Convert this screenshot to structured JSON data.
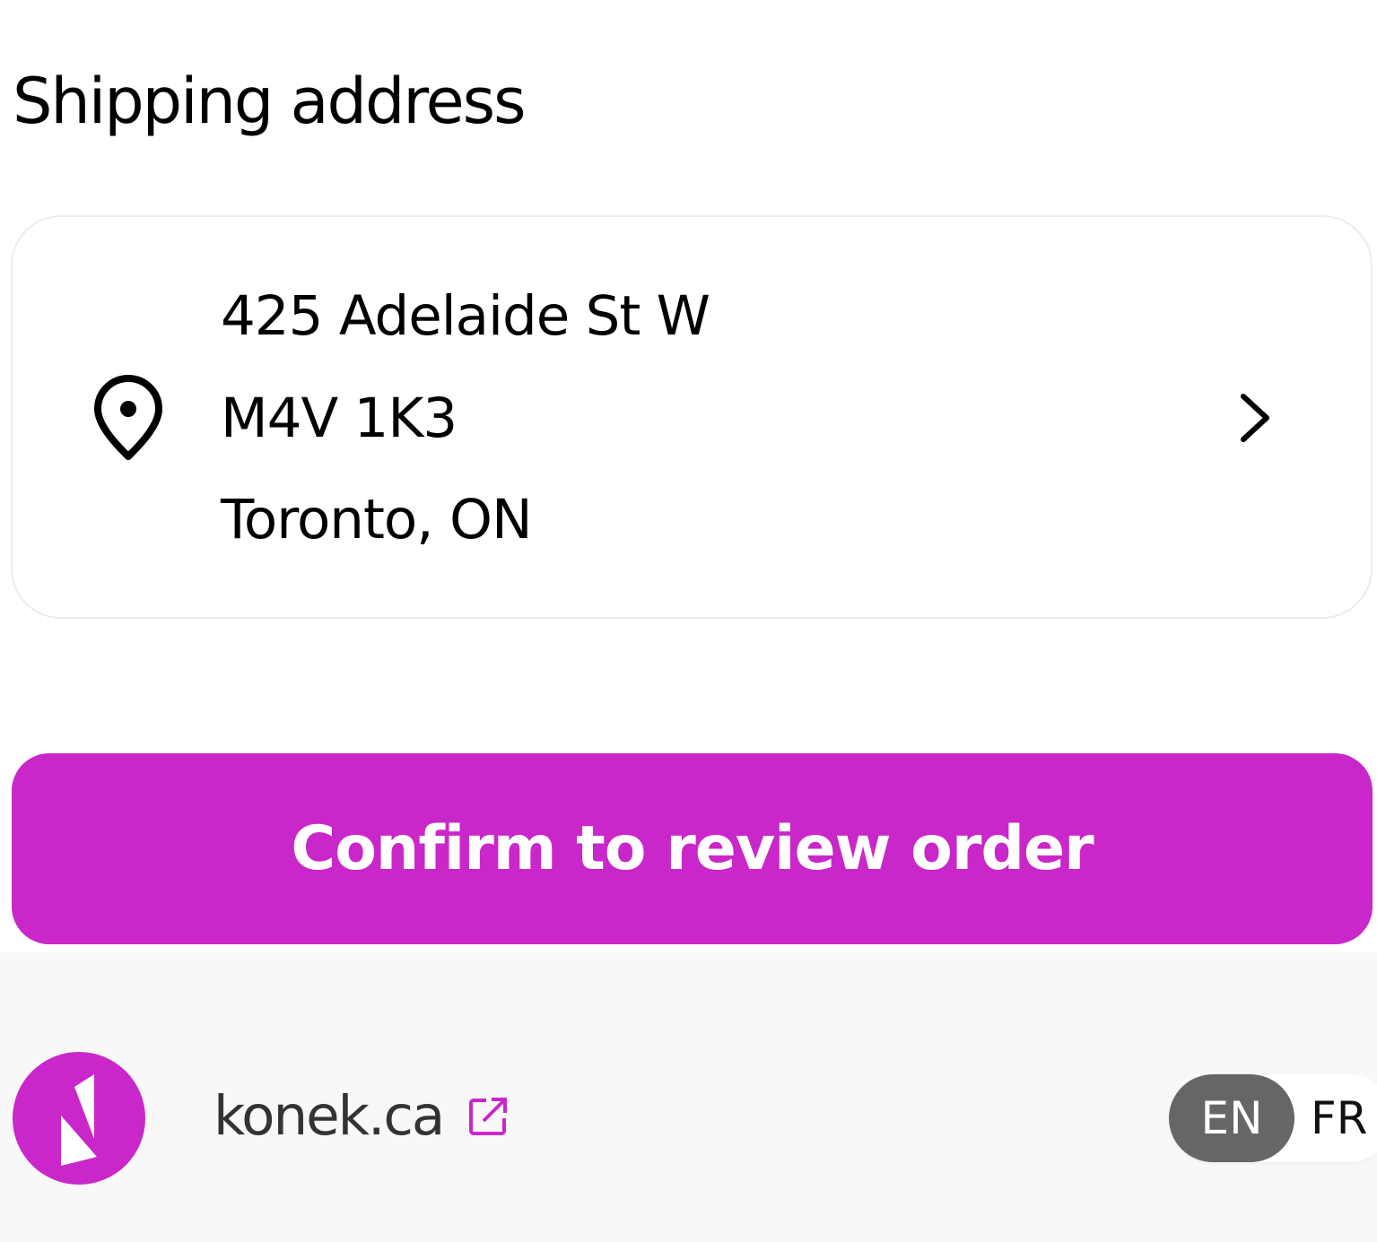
{
  "shipping": {
    "title": "Shipping address",
    "address": {
      "line1": "425 Adelaide St W",
      "line2": "M4V 1K3",
      "line3": "Toronto, ON"
    },
    "icons": {
      "pin": "map-pin-icon",
      "chevron": "chevron-right-icon"
    }
  },
  "actions": {
    "confirm_label": "Confirm to review order"
  },
  "footer": {
    "site_label": "konek.ca",
    "external_icon": "external-link-icon",
    "language": {
      "options": [
        "EN",
        "FR"
      ],
      "selected": "EN"
    }
  },
  "colors": {
    "brand": "#c927c9",
    "footer_bg": "#f8f8f8",
    "toggle_active": "#666666"
  }
}
